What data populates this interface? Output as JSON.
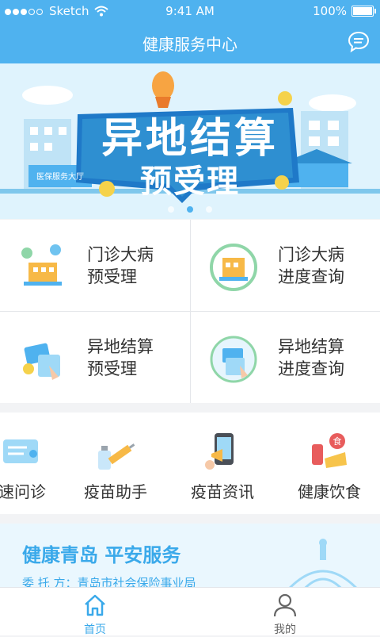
{
  "status": {
    "carrier": "Sketch",
    "time": "9:41 AM",
    "battery": "100%"
  },
  "nav": {
    "title": "健康服务中心"
  },
  "banner": {
    "line1": "异地结算",
    "line2": "预受理",
    "building": "医保服务大厅",
    "page_count": 3,
    "active_page": 2
  },
  "services": [
    {
      "line1": "门诊大病",
      "line2": "预受理"
    },
    {
      "line1": "门诊大病",
      "line2": "进度查询"
    },
    {
      "line1": "异地结算",
      "line2": "预受理"
    },
    {
      "line1": "异地结算",
      "line2": "进度查询"
    }
  ],
  "quick": [
    {
      "label": "速问诊"
    },
    {
      "label": "疫苗助手"
    },
    {
      "label": "疫苗资讯"
    },
    {
      "label": "健康饮食"
    }
  ],
  "promo": {
    "headline": "健康青岛  平安服务",
    "sub": "委  托  方：青岛市社会保险事业局"
  },
  "tabs": [
    {
      "label": "首页"
    },
    {
      "label": "我的"
    }
  ],
  "colors": {
    "primary": "#4fb2ef",
    "accent": "#3aa9ea"
  }
}
